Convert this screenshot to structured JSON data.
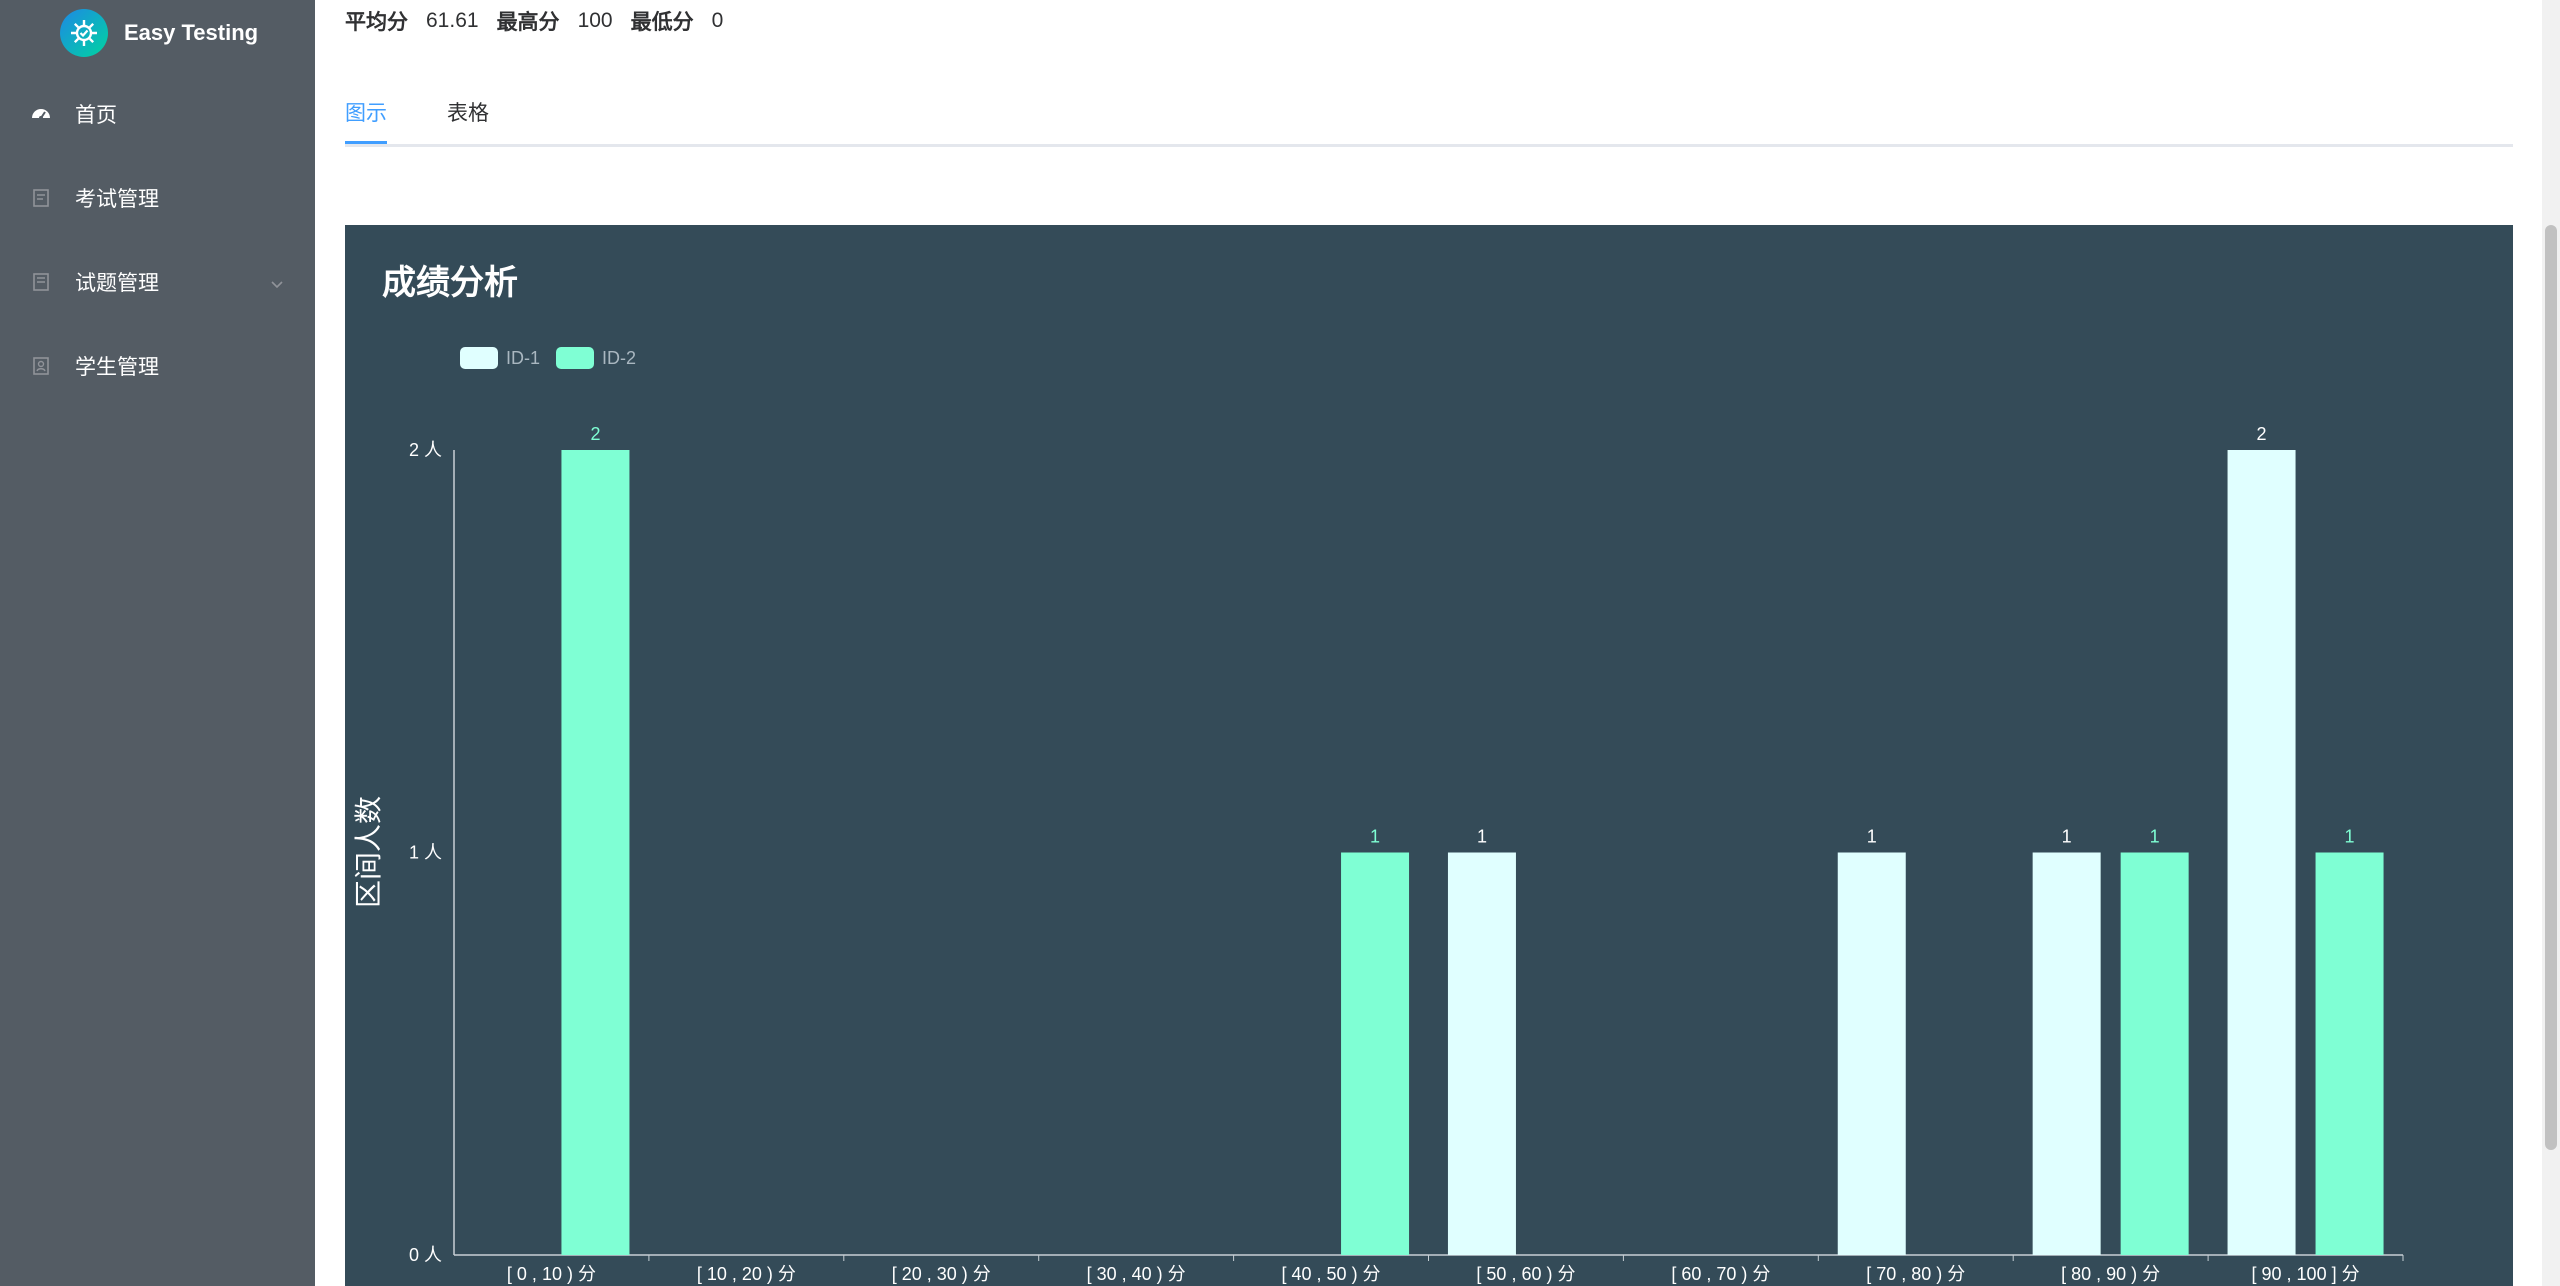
{
  "app": {
    "name": "Easy Testing"
  },
  "sidebar": {
    "items": [
      {
        "label": "首页",
        "icon": "dashboard-icon"
      },
      {
        "label": "考试管理",
        "icon": "exam-icon"
      },
      {
        "label": "试题管理",
        "icon": "question-icon",
        "has_submenu": true
      },
      {
        "label": "学生管理",
        "icon": "student-icon"
      }
    ]
  },
  "stats": {
    "avg_label": "平均分",
    "avg_value": "61.61",
    "max_label": "最高分",
    "max_value": "100",
    "min_label": "最低分",
    "min_value": "0"
  },
  "tabs": [
    {
      "label": "图示",
      "active": true
    },
    {
      "label": "表格",
      "active": false
    }
  ],
  "colors": {
    "sidebar_bg": "#545c64",
    "chart_bg": "#344b58",
    "series_1": "#e0ffff",
    "series_2": "#7fffd4",
    "accent": "#409eff"
  },
  "chart_data": {
    "type": "bar",
    "title": "成绩分析",
    "ylabel": "区间人数",
    "xlabel": "",
    "ylim": [
      0,
      2
    ],
    "y_ticks": [
      "0 人",
      "1 人",
      "2 人"
    ],
    "legend_position": "top-left",
    "grid": false,
    "categories": [
      "[ 0 , 10 ) 分",
      "[ 10 , 20 ) 分",
      "[ 20 , 30 ) 分",
      "[ 30 , 40 ) 分",
      "[ 40 , 50 ) 分",
      "[ 50 , 60 ) 分",
      "[ 60 , 70 ) 分",
      "[ 70 , 80 ) 分",
      "[ 80 , 90 ) 分",
      "[ 90 , 100 ] 分"
    ],
    "series": [
      {
        "name": "ID-1",
        "color": "#e0ffff",
        "values": [
          0,
          0,
          0,
          0,
          0,
          1,
          0,
          1,
          1,
          2
        ]
      },
      {
        "name": "ID-2",
        "color": "#7fffd4",
        "values": [
          2,
          0,
          0,
          0,
          1,
          0,
          0,
          0,
          1,
          1
        ]
      }
    ]
  }
}
